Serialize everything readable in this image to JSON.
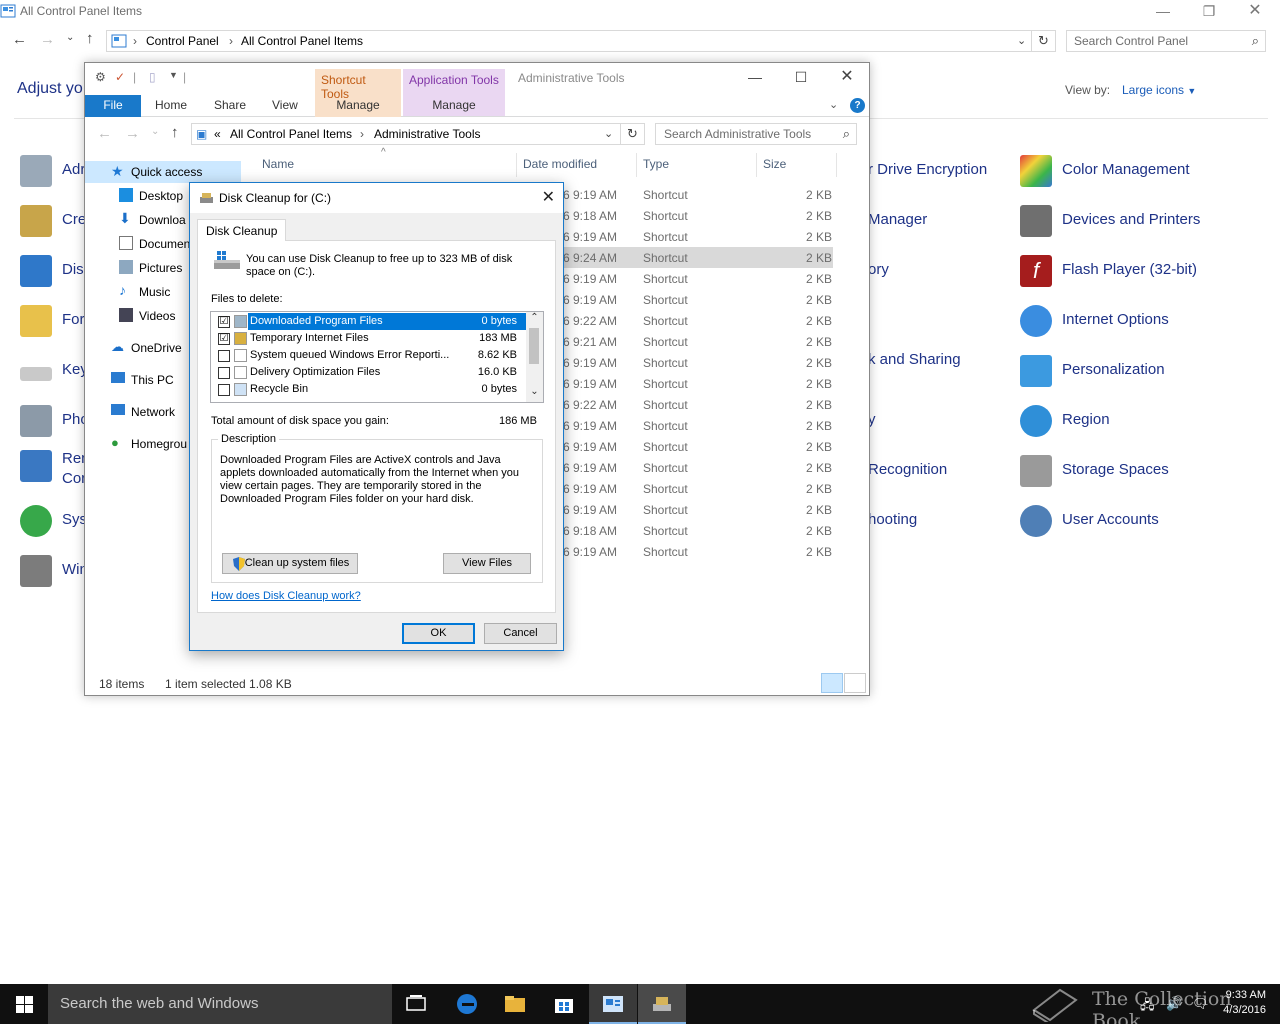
{
  "cp": {
    "title": "All Control Panel Items",
    "crumbs": [
      "Control Panel",
      "All Control Panel Items"
    ],
    "search_placeholder": "Search Control Panel",
    "heading": "Adjust yo",
    "viewby_label": "View by:",
    "viewby_value": "Large icons",
    "left_items": [
      "Adr",
      "Cre",
      "Dis",
      "For",
      "Key",
      "Pho",
      "Ren",
      "Sys",
      "Win"
    ],
    "left_items_line2": {
      "ren": "Cor"
    },
    "mid_items": [
      "r Drive Encryption",
      "Manager",
      "ory",
      "",
      "k and Sharing",
      "y",
      "Recognition",
      "hooting"
    ],
    "right_items": [
      "Color Management",
      "Devices and Printers",
      "Flash Player (32-bit)",
      "Internet Options",
      "Personalization",
      "Region",
      "Storage Spaces",
      "User Accounts"
    ]
  },
  "explorer": {
    "title": "Administrative Tools",
    "ctx_groups": [
      "Shortcut Tools",
      "Application Tools"
    ],
    "tabs": [
      "File",
      "Home",
      "Share",
      "View",
      "Manage",
      "Manage"
    ],
    "address_prefix": "«",
    "crumbs": [
      "All Control Panel Items",
      "Administrative Tools"
    ],
    "search_placeholder": "Search Administrative Tools",
    "nav": {
      "quick_access": "Quick access",
      "desktop": "Desktop",
      "downloads": "Downloa",
      "documents": "Documen",
      "pictures": "Pictures",
      "music": "Music",
      "videos": "Videos",
      "onedrive": "OneDrive",
      "thispc": "This PC",
      "network": "Network",
      "homegroup": "Homegrou"
    },
    "columns": {
      "name": "Name",
      "date": "Date modified",
      "type": "Type",
      "size": "Size"
    },
    "rows": [
      {
        "date": "6 9:19 AM",
        "type": "Shortcut",
        "size": "2 KB"
      },
      {
        "date": "6 9:18 AM",
        "type": "Shortcut",
        "size": "2 KB"
      },
      {
        "date": "6 9:19 AM",
        "type": "Shortcut",
        "size": "2 KB"
      },
      {
        "date": "6 9:24 AM",
        "type": "Shortcut",
        "size": "2 KB"
      },
      {
        "date": "6 9:19 AM",
        "type": "Shortcut",
        "size": "2 KB"
      },
      {
        "date": "6 9:19 AM",
        "type": "Shortcut",
        "size": "2 KB"
      },
      {
        "date": "6 9:22 AM",
        "type": "Shortcut",
        "size": "2 KB"
      },
      {
        "date": "6 9:21 AM",
        "type": "Shortcut",
        "size": "2 KB"
      },
      {
        "date": "6 9:19 AM",
        "type": "Shortcut",
        "size": "2 KB"
      },
      {
        "date": "6 9:19 AM",
        "type": "Shortcut",
        "size": "2 KB"
      },
      {
        "date": "6 9:22 AM",
        "type": "Shortcut",
        "size": "2 KB"
      },
      {
        "date": "6 9:19 AM",
        "type": "Shortcut",
        "size": "2 KB"
      },
      {
        "date": "6 9:19 AM",
        "type": "Shortcut",
        "size": "2 KB"
      },
      {
        "date": "6 9:19 AM",
        "type": "Shortcut",
        "size": "2 KB"
      },
      {
        "date": "6 9:19 AM",
        "type": "Shortcut",
        "size": "2 KB"
      },
      {
        "date": "6 9:19 AM",
        "type": "Shortcut",
        "size": "2 KB"
      },
      {
        "date": "6 9:18 AM",
        "type": "Shortcut",
        "size": "2 KB"
      },
      {
        "date": "6 9:19 AM",
        "type": "Shortcut",
        "size": "2 KB"
      }
    ],
    "status_count": "18 items",
    "status_selected": "1 item selected  1.08 KB"
  },
  "dialog": {
    "title": "Disk Cleanup for  (C:)",
    "tab": "Disk Cleanup",
    "intro": "You can use Disk Cleanup to free up to 323 MB of disk space on  (C:).",
    "files_label": "Files to delete:",
    "files": [
      {
        "name": "Downloaded Program Files",
        "size": "0 bytes",
        "checked": "☑",
        "selected": true
      },
      {
        "name": "Temporary Internet Files",
        "size": "183 MB",
        "checked": "☑",
        "selected": false
      },
      {
        "name": "System queued Windows Error Reporti...",
        "size": "8.62 KB",
        "checked": "",
        "selected": false
      },
      {
        "name": "Delivery Optimization Files",
        "size": "16.0 KB",
        "checked": "",
        "selected": false
      },
      {
        "name": "Recycle Bin",
        "size": "0 bytes",
        "checked": "",
        "selected": false
      }
    ],
    "gain_label": "Total amount of disk space you gain:",
    "gain_value": "186 MB",
    "desc_legend": "Description",
    "desc_text": "Downloaded Program Files are ActiveX controls and Java applets downloaded automatically from the Internet when you view certain pages. They are temporarily stored in the Downloaded Program Files folder on your hard disk.",
    "cleanup_btn": "Clean up system files",
    "view_btn": "View Files",
    "help_link": "How does Disk Cleanup work?",
    "ok": "OK",
    "cancel": "Cancel"
  },
  "taskbar": {
    "search_placeholder": "Search the web and Windows",
    "time": "9:33 AM",
    "date": "4/3/2016",
    "watermark": "The Collection Book"
  }
}
